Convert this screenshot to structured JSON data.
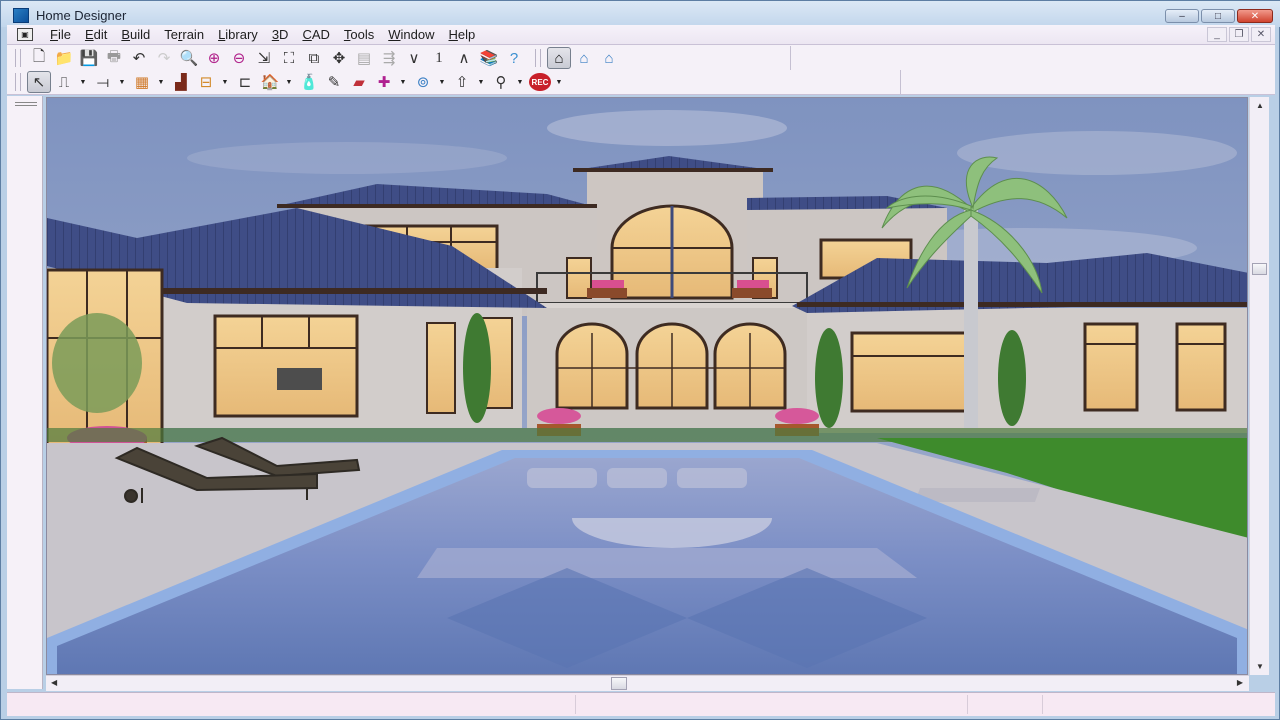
{
  "window": {
    "title": "Home Designer",
    "icon": "home-designer-app-icon",
    "controls": {
      "minimize": "–",
      "maximize": "□",
      "close": "✕"
    }
  },
  "menubar": {
    "system_icon": "document-system-menu-icon",
    "items": [
      {
        "label": "File",
        "mnemonic": "F"
      },
      {
        "label": "Edit",
        "mnemonic": "E"
      },
      {
        "label": "Build",
        "mnemonic": "B"
      },
      {
        "label": "Terrain",
        "mnemonic": "r"
      },
      {
        "label": "Library",
        "mnemonic": "L"
      },
      {
        "label": "3D",
        "mnemonic": "3"
      },
      {
        "label": "CAD",
        "mnemonic": "C"
      },
      {
        "label": "Tools",
        "mnemonic": "T"
      },
      {
        "label": "Window",
        "mnemonic": "W"
      },
      {
        "label": "Help",
        "mnemonic": "H"
      }
    ],
    "mdi_controls": {
      "minimize": "_",
      "restore": "❐",
      "close": "✕"
    }
  },
  "toolbar_top": [
    {
      "name": "new-plan",
      "glyph": "🗋"
    },
    {
      "name": "open-plan",
      "glyph": "📁"
    },
    {
      "name": "save",
      "glyph": "💾"
    },
    {
      "name": "print",
      "glyph": "🖶"
    },
    {
      "name": "undo",
      "glyph": "↶"
    },
    {
      "name": "redo",
      "glyph": "↷"
    },
    {
      "name": "zoom",
      "glyph": "🔍"
    },
    {
      "name": "zoom-in",
      "glyph": "⊕"
    },
    {
      "name": "zoom-out",
      "glyph": "⊖"
    },
    {
      "name": "undo-zoom",
      "glyph": "⇲"
    },
    {
      "name": "fill-window",
      "glyph": "⛶"
    },
    {
      "name": "fill-window-building",
      "glyph": "⧉"
    },
    {
      "name": "pan",
      "glyph": "✥"
    },
    {
      "name": "layer-display",
      "glyph": "▤"
    },
    {
      "name": "reference-display",
      "glyph": "⇶"
    },
    {
      "name": "down-one-floor",
      "glyph": "∨"
    },
    {
      "name": "floor-number",
      "glyph": "1"
    },
    {
      "name": "up-one-floor",
      "glyph": "∧"
    },
    {
      "name": "library-browser",
      "glyph": "📚"
    },
    {
      "name": "help",
      "glyph": "?"
    },
    {
      "name": "camera-view",
      "glyph": "⌂",
      "pressed": true
    },
    {
      "name": "dollhouse-view",
      "glyph": "⌂"
    },
    {
      "name": "elevation-view",
      "glyph": "⌂"
    }
  ],
  "toolbar_bottom": [
    {
      "name": "select-objects",
      "glyph": "↖",
      "pressed": true
    },
    {
      "name": "draw-walls",
      "glyph": "⎍",
      "dropdown": true
    },
    {
      "name": "draw-railing",
      "glyph": "⟞",
      "dropdown": true
    },
    {
      "name": "cabinet-tools",
      "glyph": "▦",
      "dropdown": true
    },
    {
      "name": "fireplace",
      "glyph": "▟"
    },
    {
      "name": "electrical",
      "glyph": "⊟",
      "dropdown": true
    },
    {
      "name": "dimension",
      "glyph": "⊏"
    },
    {
      "name": "camera",
      "glyph": "🏠",
      "dropdown": true
    },
    {
      "name": "material-painter",
      "glyph": "🧴"
    },
    {
      "name": "eyedropper",
      "glyph": "✎"
    },
    {
      "name": "color-material",
      "glyph": "▰"
    },
    {
      "name": "adjust-material",
      "glyph": "✚",
      "dropdown": true
    },
    {
      "name": "move-camera",
      "glyph": "⊚",
      "dropdown": true
    },
    {
      "name": "walkthrough-arrow",
      "glyph": "⇧",
      "dropdown": true
    },
    {
      "name": "walkthrough-path",
      "glyph": "⚲",
      "dropdown": true
    },
    {
      "name": "record-walkthrough",
      "glyph": "REC",
      "dropdown": true
    }
  ],
  "scrollbars": {
    "up_arrow": "▲",
    "down_arrow": "▼",
    "left_arrow": "◀",
    "right_arrow": "▶"
  },
  "viewport": {
    "view_type": "3D camera rendering",
    "scene": "Mediterranean-style two-story house with blue tile roof, arched windows, palm tree, lounge chairs and rectangular swimming pool at dusk"
  },
  "colors": {
    "sky": "#8c9dc6",
    "roof": "#3e4c85",
    "wall": "#cfcbca",
    "window_glow": "#efc784",
    "trim": "#4a3326",
    "pool": "#6d86c0",
    "pool_edge": "#8fb0e3",
    "deck": "#c9c6cb",
    "lawn": "#3c8a2c",
    "palm": "#88c07a"
  }
}
